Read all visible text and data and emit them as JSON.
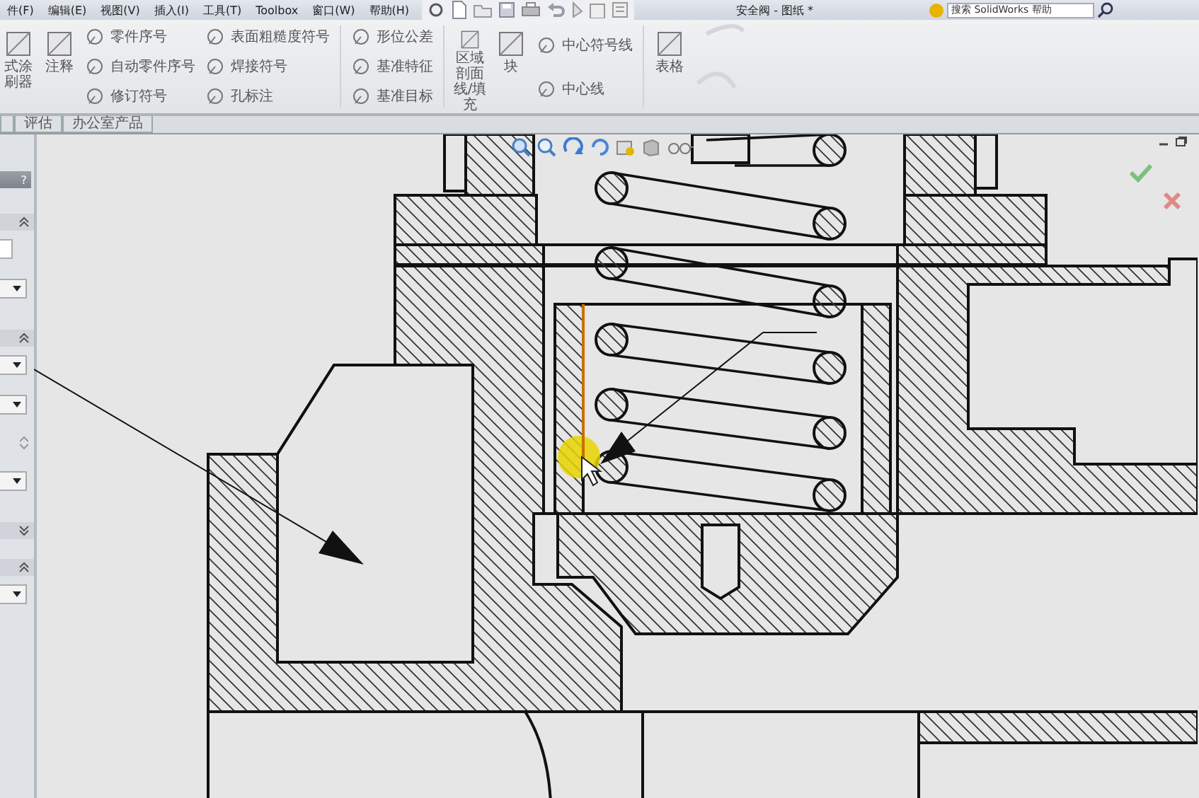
{
  "menu_bar": {
    "items": [
      {
        "label": "件(F)"
      },
      {
        "label": "编辑(E)"
      },
      {
        "label": "视图(V)"
      },
      {
        "label": "插入(I)"
      },
      {
        "label": "工具(T)"
      },
      {
        "label": "Toolbox"
      },
      {
        "label": "窗口(W)"
      },
      {
        "label": "帮助(H)"
      }
    ]
  },
  "window": {
    "title": "安全阀 - 图纸 *"
  },
  "search": {
    "placeholder": "搜索 SolidWorks 帮助"
  },
  "ribbon": {
    "columns": [
      {
        "kind": "large",
        "label": "式涂刷器"
      },
      {
        "kind": "large",
        "label": "注释"
      },
      {
        "kind": "stack",
        "items": [
          "零件序号",
          "自动零件序号",
          "修订符号"
        ]
      },
      {
        "kind": "stack",
        "items": [
          "表面粗糙度符号",
          "焊接符号",
          "孔标注"
        ]
      },
      {
        "kind": "separator"
      },
      {
        "kind": "stack",
        "items": [
          "形位公差",
          "基准特征",
          "基准目标"
        ]
      },
      {
        "kind": "separator"
      },
      {
        "kind": "large",
        "label": "区域剖面线/填充"
      },
      {
        "kind": "large",
        "label": "块"
      },
      {
        "kind": "stack",
        "items": [
          "中心符号线",
          "中心线"
        ]
      },
      {
        "kind": "separator"
      },
      {
        "kind": "large",
        "label": "表格"
      }
    ]
  },
  "tabs": [
    {
      "label": "评估",
      "selected": false
    },
    {
      "label": "办公室产品",
      "selected": false
    }
  ],
  "property_panel": {
    "help_label": "?",
    "sections": [
      {
        "expanded": true,
        "controls": [
          {
            "kind": "field"
          },
          {
            "kind": "dropdown"
          }
        ]
      },
      {
        "expanded": true,
        "controls": [
          {
            "kind": "dropdown"
          },
          {
            "kind": "dropdown"
          },
          {
            "kind": "spinner"
          },
          {
            "kind": "dropdown"
          }
        ]
      },
      {
        "expanded": false
      },
      {
        "expanded": true,
        "controls": [
          {
            "kind": "dropdown"
          }
        ]
      }
    ]
  }
}
